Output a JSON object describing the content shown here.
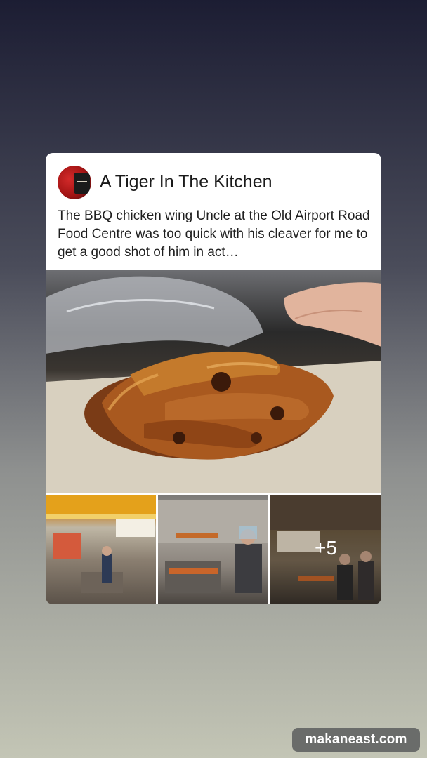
{
  "post": {
    "source_name": "A Tiger In The Kitchen",
    "avatar_icon": "tiger-kitchen-logo",
    "snippet": "The BBQ chicken wing Uncle at the Old Airport Road Food Centre was too quick with his cleaver for me to get a good shot of him in act…",
    "hero_image": "bbq-chicken-wings-on-paper",
    "thumbnails": [
      {
        "image": "hawker-stall-front"
      },
      {
        "image": "uncle-grilling-wings"
      },
      {
        "image": "stall-signboard-bbq-chicken-wing"
      }
    ],
    "more_count": "+5"
  },
  "watermark": "makaneast.com"
}
